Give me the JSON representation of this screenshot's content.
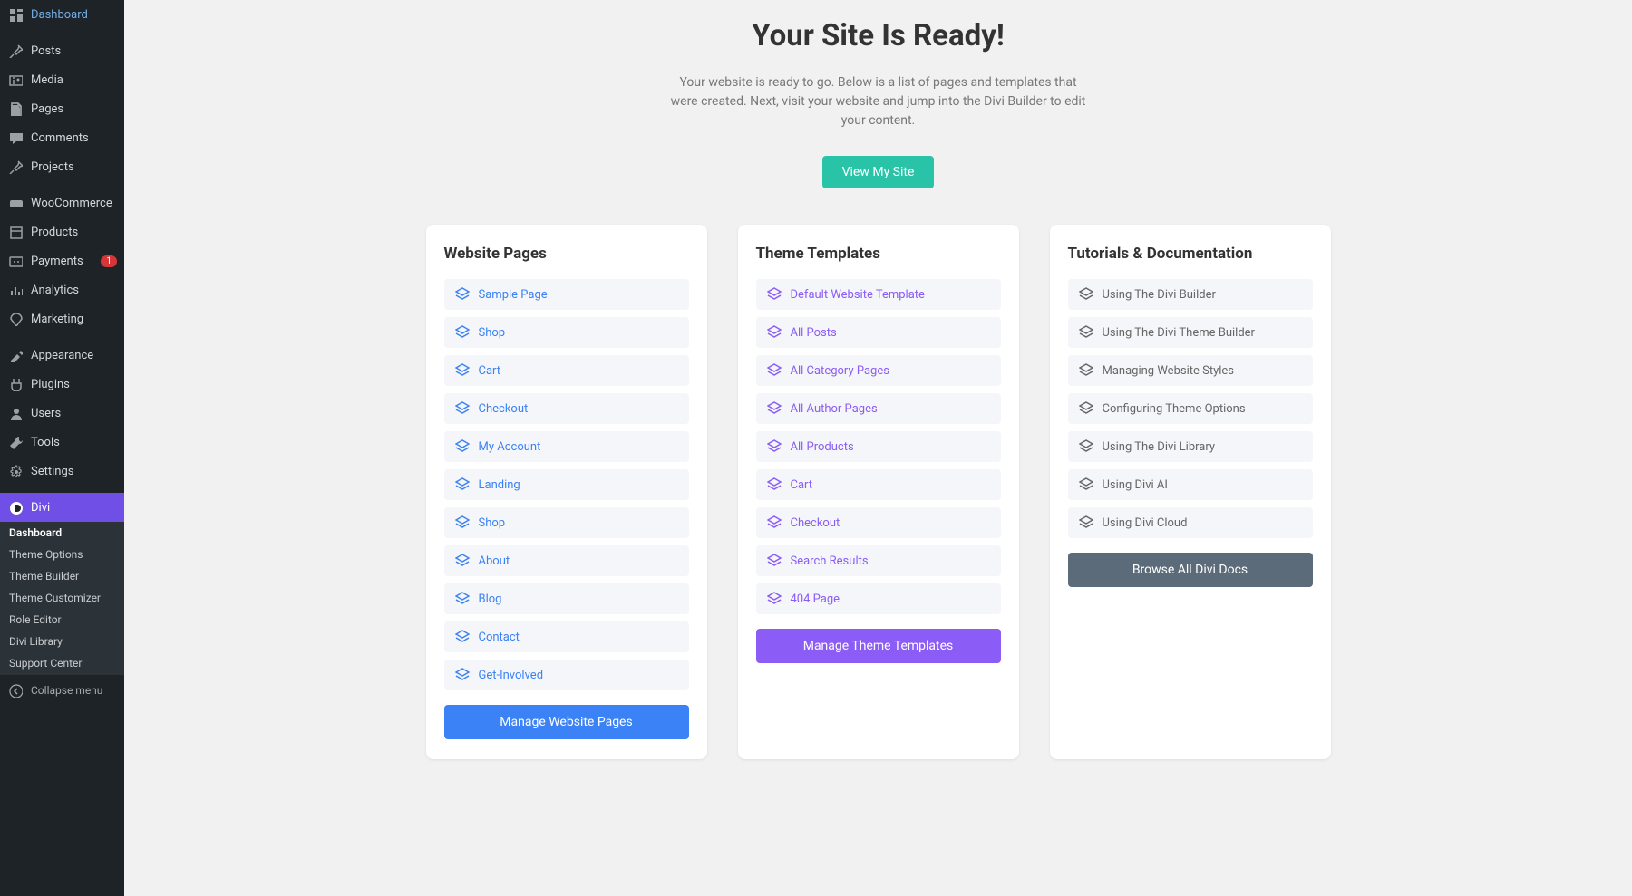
{
  "sidebar": {
    "items": [
      {
        "label": "Dashboard",
        "icon": "dashboard"
      },
      {
        "label": "Posts",
        "icon": "pin"
      },
      {
        "label": "Media",
        "icon": "media"
      },
      {
        "label": "Pages",
        "icon": "page"
      },
      {
        "label": "Comments",
        "icon": "comment"
      },
      {
        "label": "Projects",
        "icon": "pin"
      },
      {
        "label": "WooCommerce",
        "icon": "woo"
      },
      {
        "label": "Products",
        "icon": "products"
      },
      {
        "label": "Payments",
        "icon": "payments",
        "badge": "1"
      },
      {
        "label": "Analytics",
        "icon": "analytics"
      },
      {
        "label": "Marketing",
        "icon": "marketing"
      },
      {
        "label": "Appearance",
        "icon": "appearance"
      },
      {
        "label": "Plugins",
        "icon": "plugins"
      },
      {
        "label": "Users",
        "icon": "users"
      },
      {
        "label": "Tools",
        "icon": "tools"
      },
      {
        "label": "Settings",
        "icon": "settings"
      },
      {
        "label": "Divi",
        "icon": "divi"
      }
    ],
    "submenu": [
      "Dashboard",
      "Theme Options",
      "Theme Builder",
      "Theme Customizer",
      "Role Editor",
      "Divi Library",
      "Support Center"
    ],
    "collapse": "Collapse menu"
  },
  "hero": {
    "title": "Your Site Is Ready!",
    "body": "Your website is ready to go. Below is a list of pages and templates that were created. Next, visit your website and jump into the Divi Builder to edit your content.",
    "button": "View My Site"
  },
  "cards": {
    "pages": {
      "title": "Website Pages",
      "items": [
        "Sample Page",
        "Shop",
        "Cart",
        "Checkout",
        "My Account",
        "Landing",
        "Shop",
        "About",
        "Blog",
        "Contact",
        "Get-Involved"
      ],
      "button": "Manage Website Pages"
    },
    "templates": {
      "title": "Theme Templates",
      "items": [
        "Default Website Template",
        "All Posts",
        "All Category Pages",
        "All Author Pages",
        "All Products",
        "Cart",
        "Checkout",
        "Search Results",
        "404 Page"
      ],
      "button": "Manage Theme Templates"
    },
    "docs": {
      "title": "Tutorials & Documentation",
      "items": [
        "Using The Divi Builder",
        "Using The Divi Theme Builder",
        "Managing Website Styles",
        "Configuring Theme Options",
        "Using The Divi Library",
        "Using Divi AI",
        "Using Divi Cloud"
      ],
      "button": "Browse All Divi Docs"
    }
  }
}
